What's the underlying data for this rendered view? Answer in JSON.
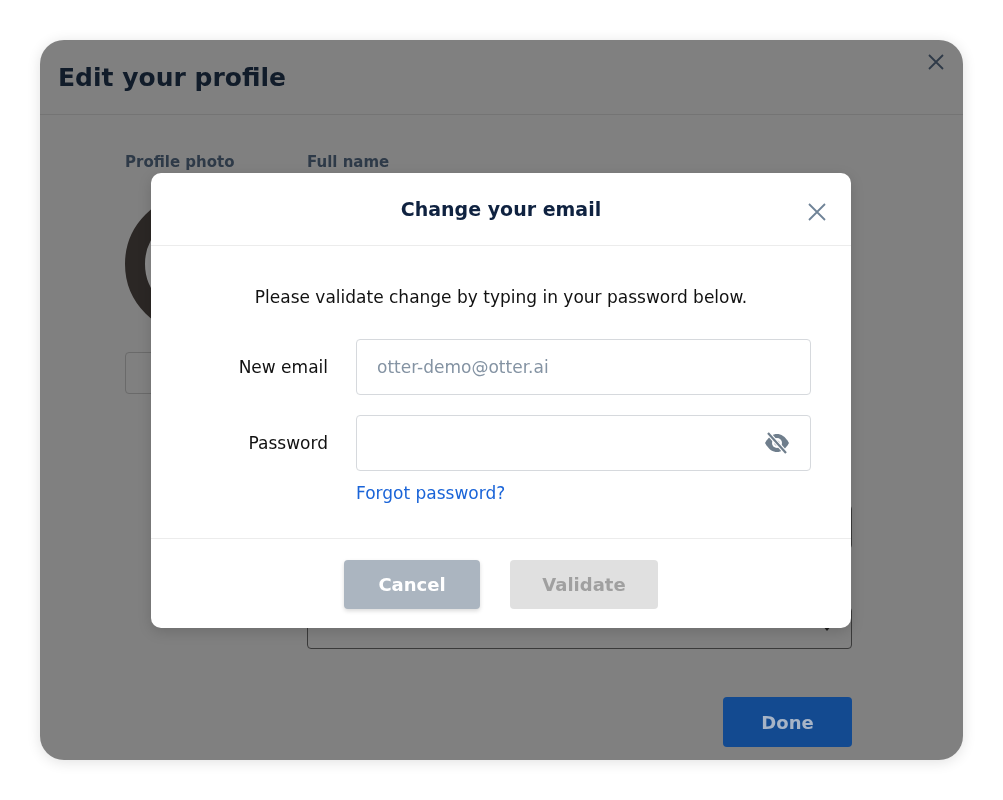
{
  "page": {
    "title": "Edit your profile",
    "labels": [
      "Profile photo",
      "Full name"
    ],
    "done_button": "Done"
  },
  "dialog": {
    "title": "Change your email",
    "instruction": "Please validate change by typing in your password below.",
    "fields": [
      {
        "label": "New email",
        "placeholder": "otter-demo@otter.ai",
        "kind": "text"
      },
      {
        "label": "Password",
        "kind": "password",
        "password_visible": false
      }
    ],
    "forgot_link": "Forgot password?",
    "buttons": [
      {
        "label": "Cancel",
        "disabled": false
      },
      {
        "label": "Validate",
        "disabled": true
      }
    ]
  }
}
